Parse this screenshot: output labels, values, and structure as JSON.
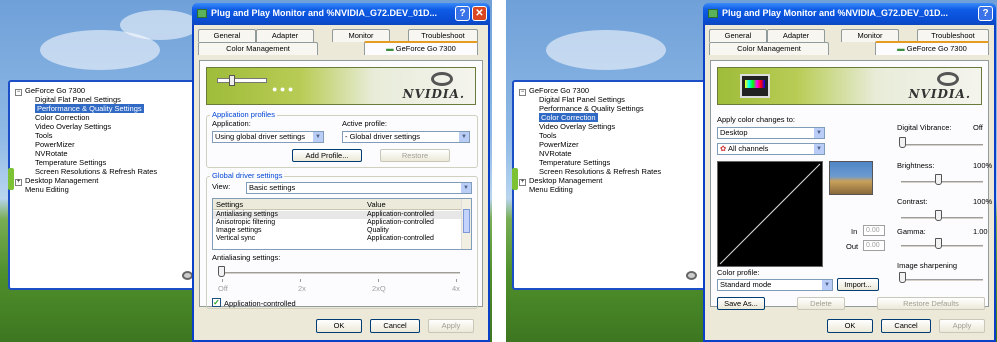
{
  "left": {
    "window_title": "Plug and Play Monitor and %NVIDIA_G72.DEV_01D...",
    "tabs_row1": [
      "General",
      "Adapter",
      "Monitor",
      "Troubleshoot"
    ],
    "tabs_row2": [
      "Color Management",
      "GeForce Go 7300"
    ],
    "tree": {
      "root": "GeForce Go 7300",
      "items": [
        "Digital Flat Panel Settings",
        "Performance & Quality Settings",
        "Color Correction",
        "Video Overlay Settings",
        "Tools",
        "PowerMizer",
        "NVRotate",
        "Temperature Settings",
        "Screen Resolutions & Refresh Rates"
      ],
      "selected_index": 1,
      "desktop_management": "Desktop Management",
      "menu_editing": "Menu Editing"
    },
    "brand": "NVIDIA.",
    "profiles": {
      "group_title": "Application profiles",
      "application_label": "Application:",
      "application_value": "Using global driver settings",
      "active_label": "Active profile:",
      "active_value": "- Global driver settings",
      "add_profile": "Add Profile...",
      "restore": "Restore"
    },
    "global": {
      "group_title": "Global driver settings",
      "view_label": "View:",
      "view_value": "Basic settings",
      "col_settings": "Settings",
      "col_value": "Value",
      "rows": [
        {
          "setting": "Antialiasing settings",
          "value": "Application-controlled"
        },
        {
          "setting": "Anisotropic filtering",
          "value": "Application-controlled"
        },
        {
          "setting": "Image settings",
          "value": "Quality"
        },
        {
          "setting": "Vertical sync",
          "value": "Application-controlled"
        }
      ],
      "slider_label": "Antialiasing settings:",
      "slider_ticks": [
        "Off",
        "2x",
        "2xQ",
        "4x"
      ],
      "checkbox_label": "Application-controlled",
      "checkbox_checked": true
    },
    "buttons": {
      "ok": "OK",
      "cancel": "Cancel",
      "apply": "Apply"
    }
  },
  "right": {
    "window_title": "Plug and Play Monitor and %NVIDIA_G72.DEV_01D...",
    "tabs_row1": [
      "General",
      "Adapter",
      "Monitor",
      "Troubleshoot"
    ],
    "tabs_row2": [
      "Color Management",
      "GeForce Go 7300"
    ],
    "tree": {
      "root": "GeForce Go 7300",
      "items": [
        "Digital Flat Panel Settings",
        "Performance & Quality Settings",
        "Color Correction",
        "Video Overlay Settings",
        "Tools",
        "PowerMizer",
        "NVRotate",
        "Temperature Settings",
        "Screen Resolutions & Refresh Rates"
      ],
      "selected_index": 2,
      "desktop_management": "Desktop Management",
      "menu_editing": "Menu Editing"
    },
    "brand": "NVIDIA.",
    "color": {
      "apply_label": "Apply color changes to:",
      "apply_value": "Desktop",
      "channels_value": "All channels",
      "digital_vibrance": "Digital Vibrance:",
      "digital_vibrance_value": "Off",
      "brightness": "Brightness:",
      "brightness_value": "100%",
      "contrast": "Contrast:",
      "contrast_value": "100%",
      "gamma": "Gamma:",
      "gamma_value": "1.00",
      "in_label": "In",
      "in_value": "0.00",
      "out_label": "Out",
      "out_value": "0.00",
      "image_sharpening": "Image sharpening",
      "color_profile_label": "Color profile:",
      "color_profile_value": "Standard mode",
      "import": "Import...",
      "save_as": "Save As...",
      "delete": "Delete",
      "restore_defaults": "Restore Defaults"
    },
    "buttons": {
      "ok": "OK",
      "cancel": "Cancel",
      "apply": "Apply"
    }
  }
}
